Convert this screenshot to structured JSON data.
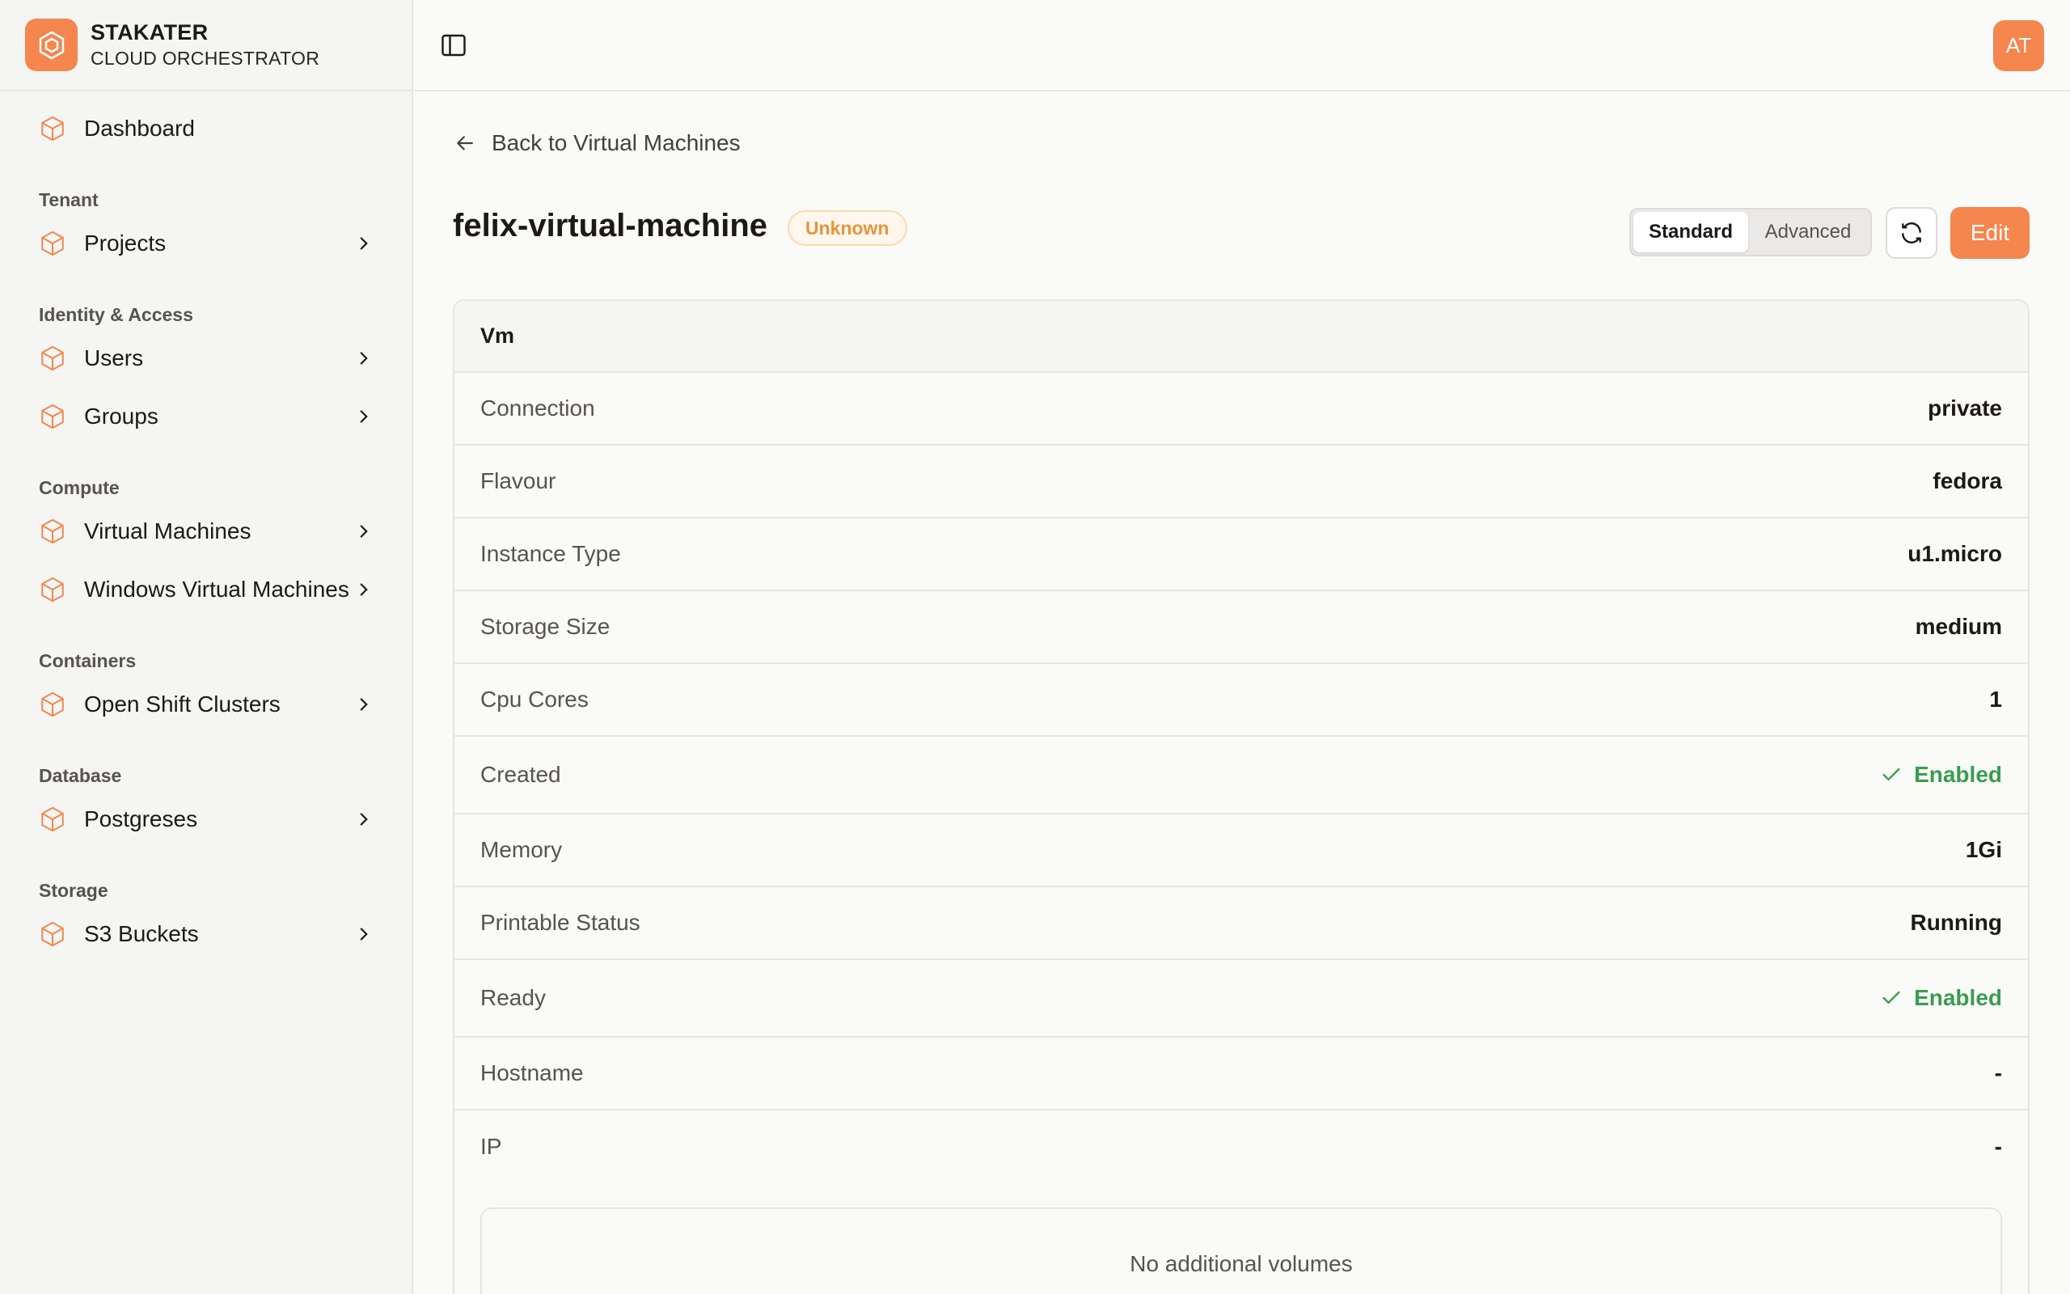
{
  "brand": {
    "name": "STAKATER",
    "subtitle": "CLOUD ORCHESTRATOR"
  },
  "sidebar": {
    "dashboard": "Dashboard",
    "sections": {
      "tenant": "Tenant",
      "identity": "Identity & Access",
      "compute": "Compute",
      "containers": "Containers",
      "database": "Database",
      "storage": "Storage"
    },
    "items": {
      "projects": "Projects",
      "users": "Users",
      "groups": "Groups",
      "virtual_machines": "Virtual Machines",
      "windows_virtual_machines": "Windows Virtual Machines",
      "open_shift_clusters": "Open Shift Clusters",
      "postgreses": "Postgreses",
      "s3_buckets": "S3 Buckets"
    }
  },
  "header": {
    "avatar_initials": "AT"
  },
  "page": {
    "back_label": "Back to Virtual Machines",
    "title": "felix-virtual-machine",
    "status": "Unknown",
    "view_standard": "Standard",
    "view_advanced": "Advanced",
    "edit_label": "Edit"
  },
  "card": {
    "title": "Vm",
    "rows": [
      {
        "key": "Connection",
        "value": "private"
      },
      {
        "key": "Flavour",
        "value": "fedora"
      },
      {
        "key": "Instance Type",
        "value": "u1.micro"
      },
      {
        "key": "Storage Size",
        "value": "medium"
      },
      {
        "key": "Cpu Cores",
        "value": "1"
      },
      {
        "key": "Created",
        "value": "Enabled"
      },
      {
        "key": "Memory",
        "value": "1Gi"
      },
      {
        "key": "Printable Status",
        "value": "Running"
      },
      {
        "key": "Ready",
        "value": "Enabled"
      },
      {
        "key": "Hostname",
        "value": "-"
      },
      {
        "key": "IP",
        "value": "-"
      }
    ],
    "volumes_empty": "No additional volumes"
  },
  "colors": {
    "accent": "#f4864e",
    "enabled": "#3a9d4e",
    "badge_text": "#e6953a"
  }
}
